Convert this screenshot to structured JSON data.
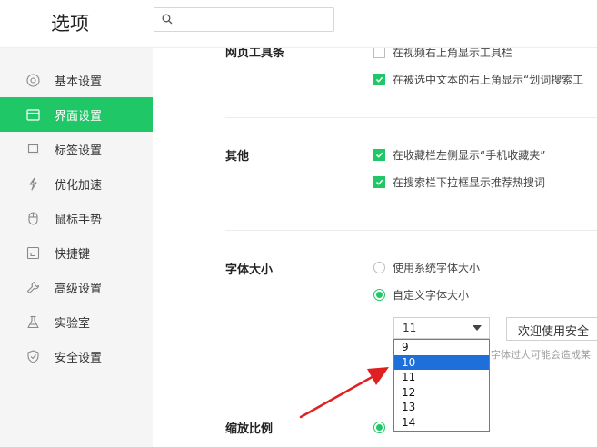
{
  "app": {
    "title": "选项"
  },
  "search": {
    "value": "",
    "placeholder": ""
  },
  "sidebar": {
    "items": [
      {
        "label": "基本设置",
        "icon": "target-icon",
        "active": false
      },
      {
        "label": "界面设置",
        "icon": "window-icon",
        "active": true
      },
      {
        "label": "标签设置",
        "icon": "laptop-icon",
        "active": false
      },
      {
        "label": "优化加速",
        "icon": "lightning-icon",
        "active": false
      },
      {
        "label": "鼠标手势",
        "icon": "mouse-icon",
        "active": false
      },
      {
        "label": "快捷键",
        "icon": "keyboard-icon",
        "active": false
      },
      {
        "label": "高级设置",
        "icon": "wrench-icon",
        "active": false
      },
      {
        "label": "实验室",
        "icon": "flask-icon",
        "active": false
      },
      {
        "label": "安全设置",
        "icon": "shield-icon",
        "active": false
      }
    ]
  },
  "sections": {
    "toolbar": {
      "label": "网页工具条",
      "options": [
        {
          "label": "在视频右上角显示工具栏",
          "checked": false
        },
        {
          "label": "在被选中文本的右上角显示“划词搜索工",
          "checked": true
        }
      ]
    },
    "other": {
      "label": "其他",
      "options": [
        {
          "label": "在收藏栏左侧显示“手机收藏夹”",
          "checked": true
        },
        {
          "label": "在搜索栏下拉框显示推荐热搜词",
          "checked": true
        }
      ]
    },
    "font_size": {
      "label": "字体大小",
      "options": [
        {
          "label": "使用系统字体大小",
          "selected": false
        },
        {
          "label": "自定义字体大小",
          "selected": true
        }
      ],
      "select_value": "11",
      "preview_text": "欢迎使用安全",
      "hint": "字体过大可能会造成某",
      "dropdown_options": [
        "9",
        "10",
        "11",
        "12",
        "13",
        "14"
      ],
      "dropdown_highlighted": "10"
    },
    "zoom": {
      "label": "缩放比例"
    }
  },
  "colors": {
    "accent": "#20c767",
    "highlight": "#1e6fd9",
    "annotation_arrow": "#e02020"
  }
}
